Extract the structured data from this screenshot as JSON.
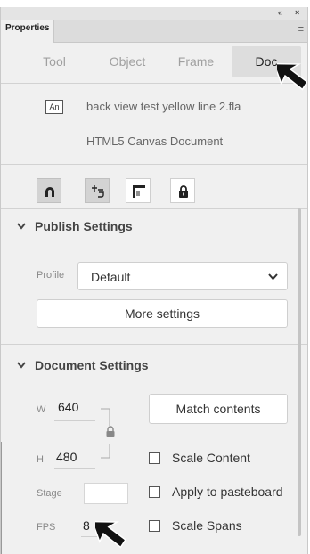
{
  "window": {
    "panel_title": "Properties",
    "collapse_glyph": "«",
    "close_glyph": "×",
    "menu_glyph": "≡"
  },
  "tabs": [
    {
      "label": "Tool",
      "active": false
    },
    {
      "label": "Object",
      "active": false
    },
    {
      "label": "Frame",
      "active": false
    },
    {
      "label": "Doc",
      "active": true
    }
  ],
  "document": {
    "badge": "An",
    "filename": "back view test yellow line 2.fla",
    "type": "HTML5 Canvas Document"
  },
  "toolbar_icons": [
    {
      "name": "magnet-icon",
      "active": true
    },
    {
      "name": "pin-edit-icon",
      "active": true
    },
    {
      "name": "corner-frame-icon",
      "active": false
    },
    {
      "name": "lock-icon",
      "active": false
    }
  ],
  "publish": {
    "title": "Publish Settings",
    "profile_label": "Profile",
    "profile_value": "Default",
    "more_label": "More settings"
  },
  "doc_settings": {
    "title": "Document Settings",
    "w_label": "W",
    "w_value": "640",
    "h_label": "H",
    "h_value": "480",
    "match_label": "Match contents",
    "scale_content": "Scale Content",
    "apply_pasteboard": "Apply to pasteboard",
    "scale_spans": "Scale Spans",
    "stage_label": "Stage",
    "stage_color": "#ffffff",
    "fps_label": "FPS",
    "fps_value": "8"
  }
}
